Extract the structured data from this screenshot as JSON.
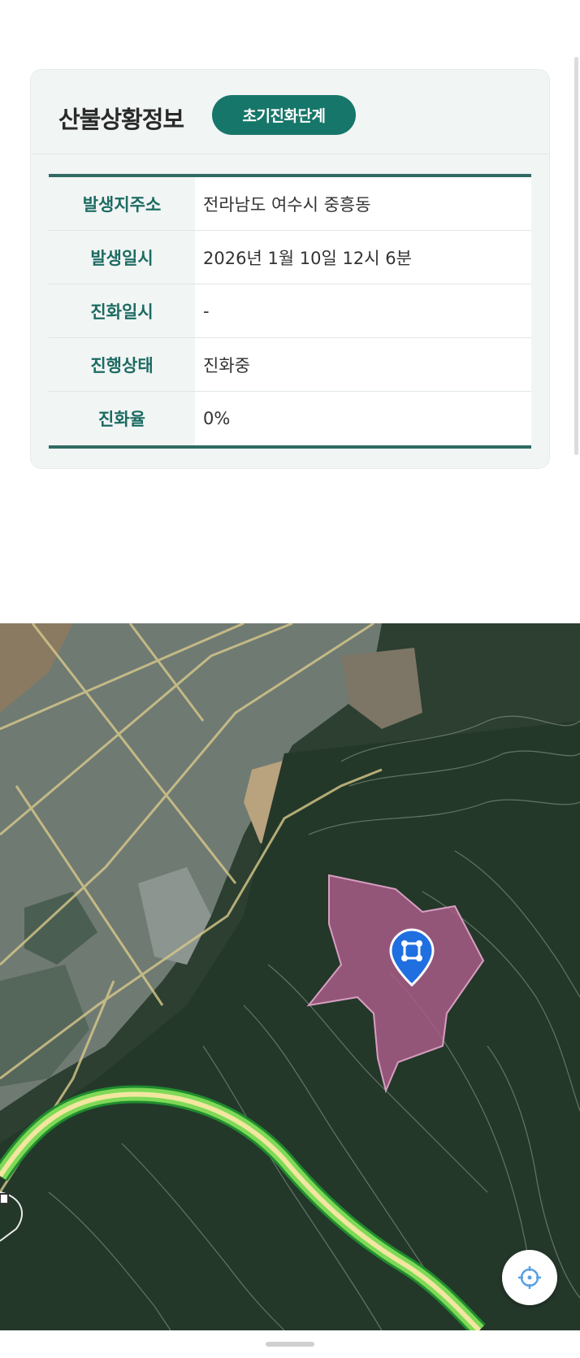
{
  "card": {
    "title": "산불상황정보",
    "badge": "초기진화단계",
    "rows": [
      {
        "label": "발생지주소",
        "value": "전라남도 여수시 중흥동"
      },
      {
        "label": "발생일시",
        "value": "2026년 1월 10일 12시 6분"
      },
      {
        "label": "진화일시",
        "value": "-"
      },
      {
        "label": "진행상태",
        "value": "진화중"
      },
      {
        "label": "진화율",
        "value": "0%"
      }
    ]
  },
  "colors": {
    "accent": "#17766a",
    "label_text": "#1c6b62",
    "table_border": "#2f6b63",
    "fire_area": "#a85c86",
    "marker": "#1f6fe0",
    "highway": "#7ed957"
  },
  "map": {
    "marker_icon": "fire-location-pin-icon",
    "locate_icon": "crosshair-icon"
  }
}
